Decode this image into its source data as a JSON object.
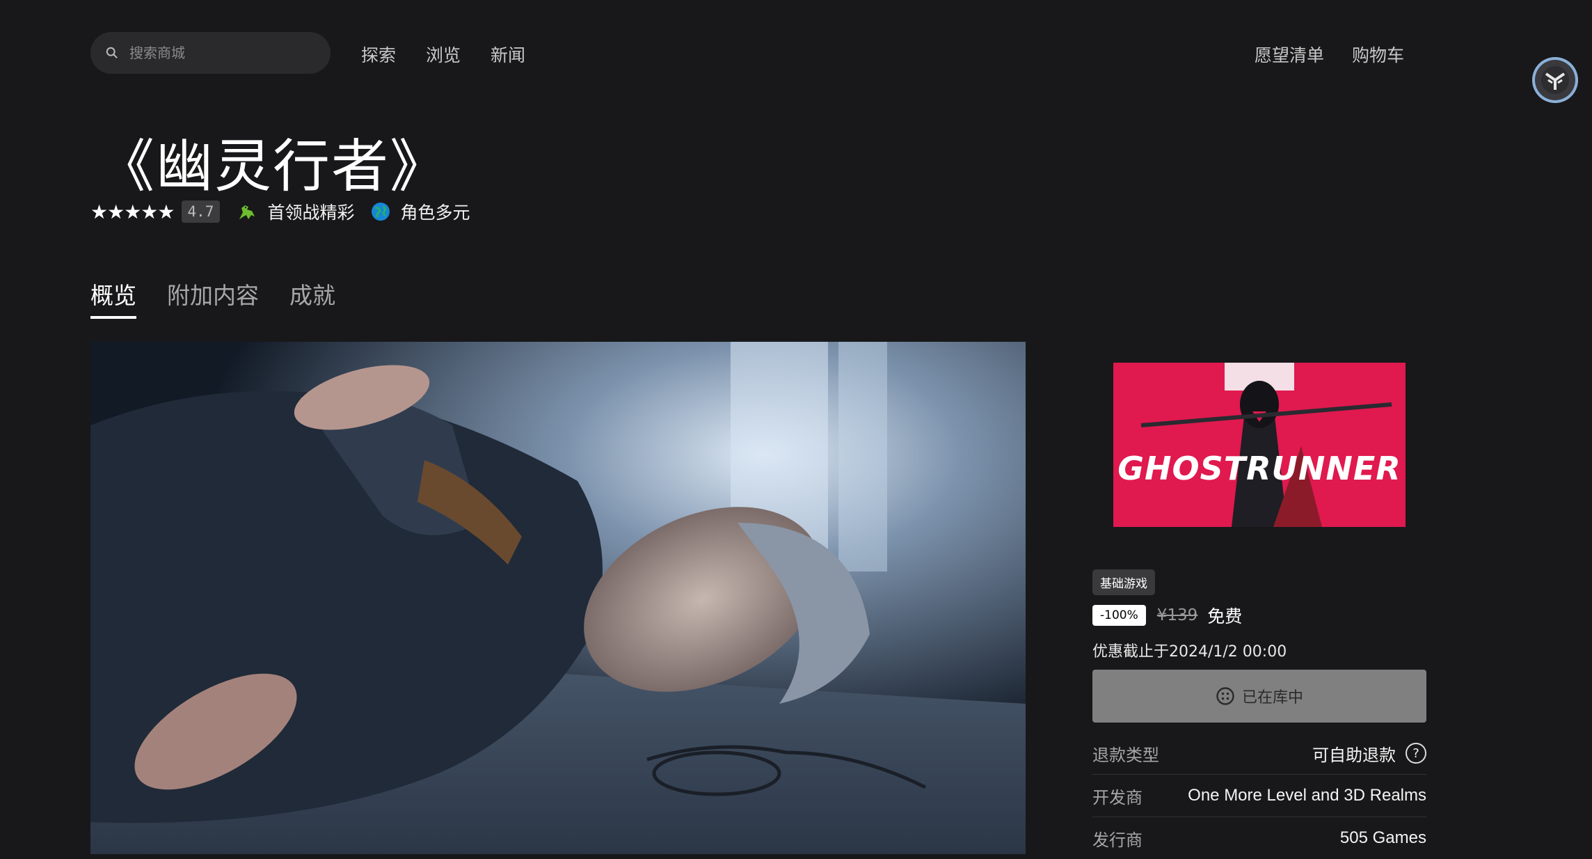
{
  "header": {
    "search_placeholder": "搜索商城",
    "nav": [
      "探索",
      "浏览",
      "新闻"
    ],
    "right_nav": [
      "愿望清单",
      "购物车"
    ]
  },
  "game": {
    "title": "《幽灵行者》",
    "stars": "★★★★★",
    "rating": "4.7",
    "tags": [
      {
        "icon": "dinosaur-icon",
        "label": "首领战精彩"
      },
      {
        "icon": "globe-icon",
        "label": "角色多元"
      }
    ]
  },
  "tabs": [
    "概览",
    "附加内容",
    "成就"
  ],
  "cover_title": "GHOSTRUNNER",
  "purchase": {
    "badge": "基础游戏",
    "discount": "-100%",
    "original_price": "¥139",
    "final_price": "免费",
    "sale_end": "优惠截止于2024/1/2 00:00",
    "library_button": "已在库中"
  },
  "details": [
    {
      "key": "退款类型",
      "value": "可自助退款"
    },
    {
      "key": "开发商",
      "value": "One More Level and 3D Realms"
    },
    {
      "key": "发行商",
      "value": "505 Games"
    }
  ],
  "colors": {
    "background": "#18181a",
    "cover_accent": "#e0194f",
    "button_disabled": "#808080"
  }
}
